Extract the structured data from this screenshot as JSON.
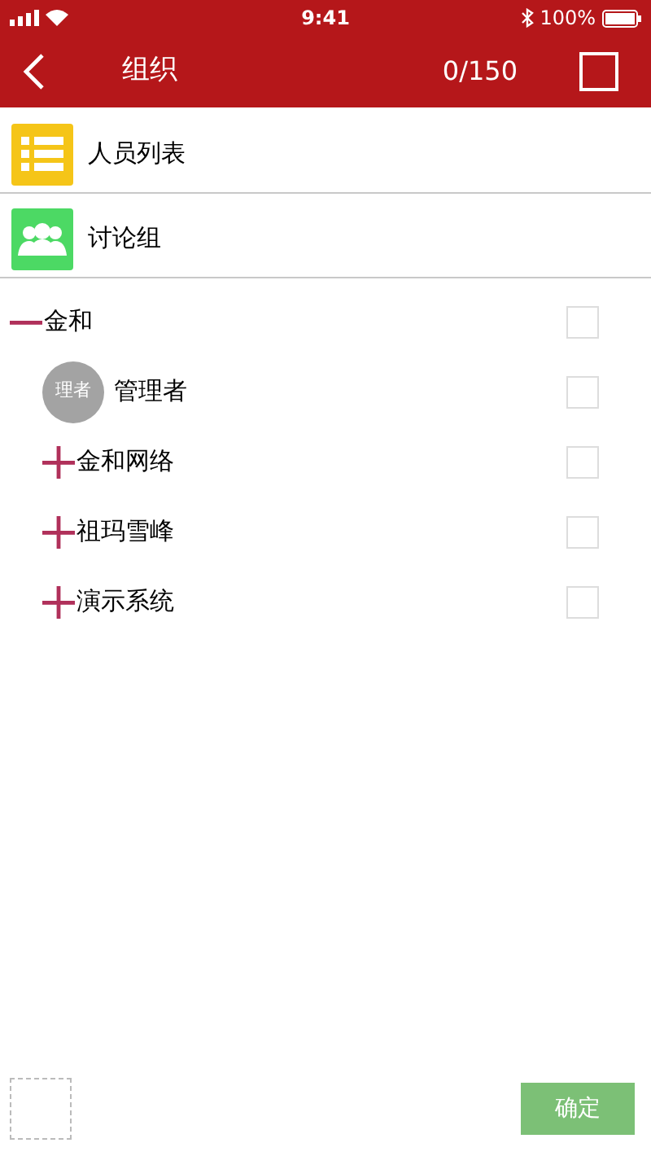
{
  "status_bar": {
    "time": "9:41",
    "battery": "100%"
  },
  "nav": {
    "title": "组织",
    "count": "0/150",
    "select_all": {
      "checked": false
    }
  },
  "menu": [
    {
      "kind": "list",
      "label": "人员列表"
    },
    {
      "kind": "group",
      "label": "讨论组"
    }
  ],
  "tree": [
    {
      "kind": "org",
      "label": "金和",
      "expanded": true,
      "checked": false,
      "children": [
        {
          "kind": "member",
          "label": "管理者",
          "avatar": "理者",
          "checked": false
        },
        {
          "kind": "org",
          "label": "金和网络",
          "expanded": false,
          "checked": false
        },
        {
          "kind": "org",
          "label": "祖玛雪峰",
          "expanded": false,
          "checked": false
        },
        {
          "kind": "org",
          "label": "演示系统",
          "expanded": false,
          "checked": false
        }
      ]
    }
  ],
  "footer": {
    "confirm": {
      "label": "确定",
      "disabled": true
    }
  }
}
